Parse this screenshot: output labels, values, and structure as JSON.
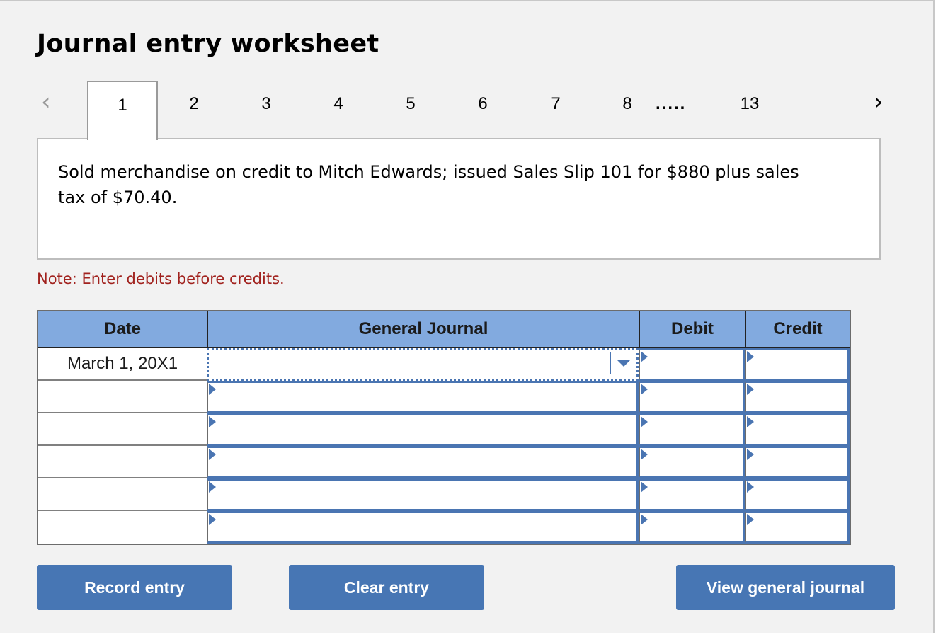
{
  "title": "Journal entry worksheet",
  "pagination": {
    "prev_icon": "chevron-left-icon",
    "next_icon": "chevron-right-icon",
    "tabs": [
      "1",
      "2",
      "3",
      "4",
      "5",
      "6",
      "7",
      "8",
      "13"
    ],
    "active_tab": "1",
    "ellipsis": "....."
  },
  "transaction": {
    "description": "Sold merchandise on credit to Mitch Edwards; issued Sales Slip 101 for $880 plus sales tax of $70.40."
  },
  "note": "Note: Enter debits before credits.",
  "journal": {
    "headers": {
      "date": "Date",
      "account": "General Journal",
      "debit": "Debit",
      "credit": "Credit"
    },
    "rows": [
      {
        "date": "March 1, 20X1",
        "account": "",
        "debit": "",
        "credit": ""
      },
      {
        "date": "",
        "account": "",
        "debit": "",
        "credit": ""
      },
      {
        "date": "",
        "account": "",
        "debit": "",
        "credit": ""
      },
      {
        "date": "",
        "account": "",
        "debit": "",
        "credit": ""
      },
      {
        "date": "",
        "account": "",
        "debit": "",
        "credit": ""
      },
      {
        "date": "",
        "account": "",
        "debit": "",
        "credit": ""
      }
    ]
  },
  "buttons": {
    "record": "Record entry",
    "clear": "Clear entry",
    "view": "View general journal"
  },
  "colors": {
    "header_bg": "#82aadf",
    "button_bg": "#4776b4",
    "note_text": "#a1221e",
    "input_border": "#4a75b2"
  }
}
